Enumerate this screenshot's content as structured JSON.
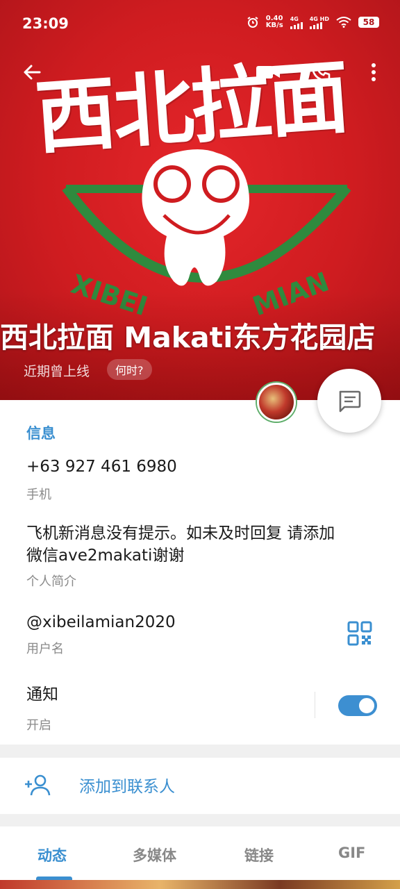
{
  "status_bar": {
    "time": "23:09",
    "net_speed_value": "0.40",
    "net_speed_unit": "KB/s",
    "network_1": "4G",
    "network_2": "4G HD",
    "battery": "58"
  },
  "header": {
    "logo_text": "西北拉面",
    "profile_name": "西北拉面 Makati东方花园店",
    "last_seen": "近期曾上线",
    "when_chip": "何时?"
  },
  "info": {
    "section_title": "信息",
    "phone_value": "+63 927 461 6980",
    "phone_label": "手机",
    "bio_line1": "飞机新消息没有提示。如未及时回复 请添加",
    "bio_line2": "微信ave2makati谢谢",
    "bio_label": "个人简介",
    "username_value": "@xibeilamian2020",
    "username_label": "用户名",
    "notify_value": "通知",
    "notify_label": "开启",
    "notify_enabled": true
  },
  "actions": {
    "add_contact": "添加到联系人"
  },
  "tabs": [
    {
      "label": "动态",
      "active": true
    },
    {
      "label": "多媒体",
      "active": false
    },
    {
      "label": "链接",
      "active": false
    },
    {
      "label": "GIF",
      "active": false
    }
  ],
  "colors": {
    "accent": "#3a8fd0",
    "header_red": "#cf1c20"
  }
}
